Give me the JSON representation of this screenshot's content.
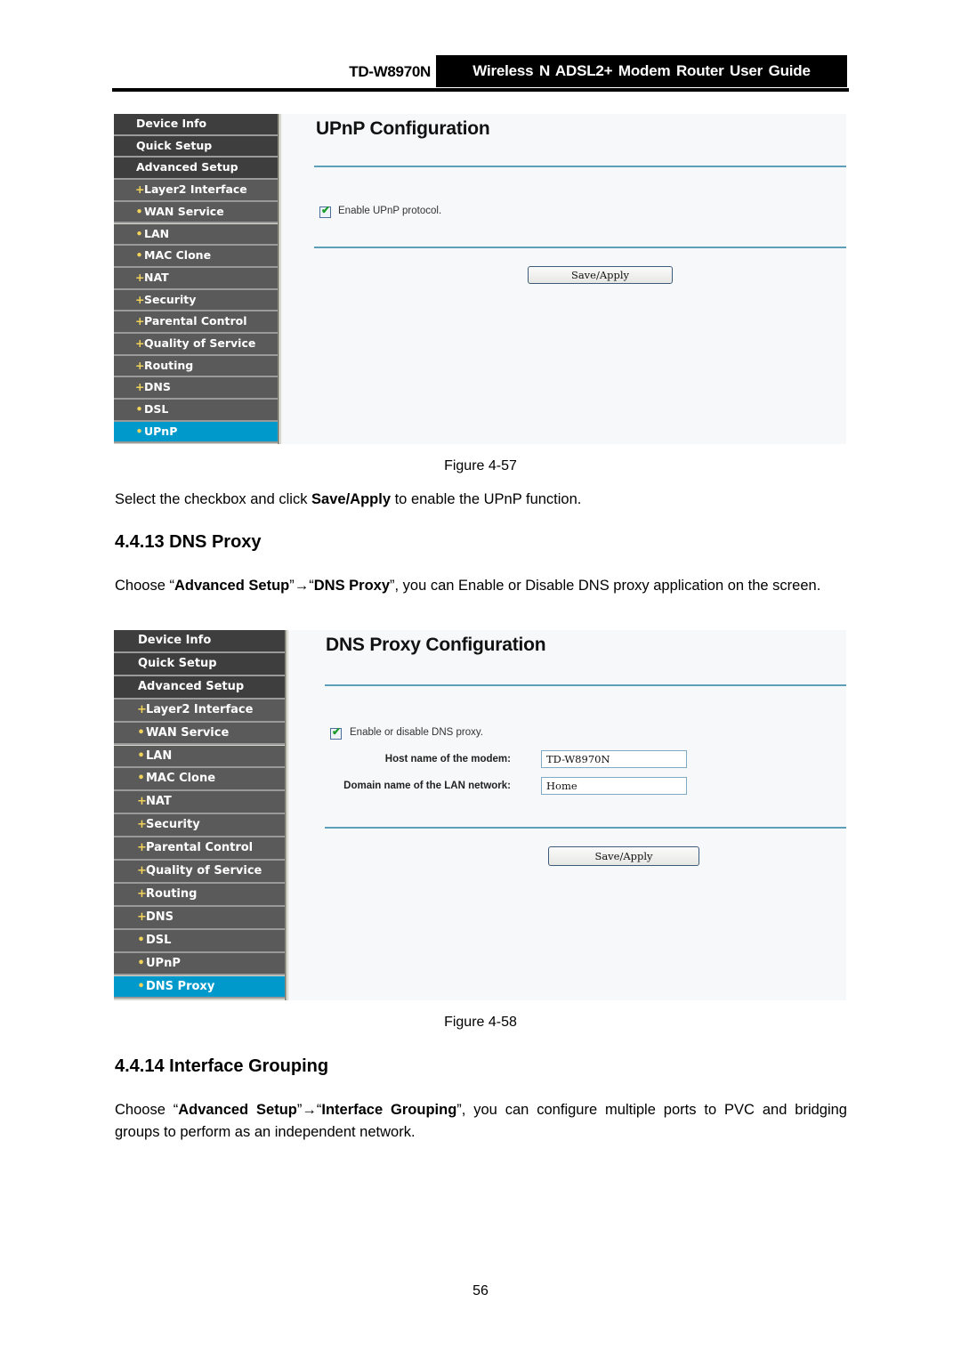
{
  "header": {
    "model": "TD-W8970N",
    "guide_title": "Wireless N ADSL2+ Modem Router User Guide"
  },
  "figure57": {
    "sidebar": [
      {
        "label": "Device Info",
        "bullet": "",
        "level": "top"
      },
      {
        "label": "Quick Setup",
        "bullet": "",
        "level": "top"
      },
      {
        "label": "Advanced Setup",
        "bullet": "",
        "level": "top"
      },
      {
        "label": "Layer2 Interface",
        "bullet": "+",
        "level": "sub"
      },
      {
        "label": "WAN Service",
        "bullet": "•",
        "level": "sub"
      },
      {
        "label": "LAN",
        "bullet": "•",
        "level": "sub"
      },
      {
        "label": "MAC Clone",
        "bullet": "•",
        "level": "sub"
      },
      {
        "label": "NAT",
        "bullet": "+",
        "level": "sub"
      },
      {
        "label": "Security",
        "bullet": "+",
        "level": "sub"
      },
      {
        "label": "Parental Control",
        "bullet": "+",
        "level": "sub"
      },
      {
        "label": "Quality of Service",
        "bullet": "+",
        "level": "sub"
      },
      {
        "label": "Routing",
        "bullet": "+",
        "level": "sub"
      },
      {
        "label": "DNS",
        "bullet": "+",
        "level": "sub"
      },
      {
        "label": "DSL",
        "bullet": "•",
        "level": "sub"
      },
      {
        "label": "UPnP",
        "bullet": "•",
        "level": "active"
      }
    ],
    "title": "UPnP Configuration",
    "checkbox_label": "Enable UPnP protocol.",
    "checkbox_checked": true,
    "save_button": "Save/Apply",
    "caption": "Figure 4-57"
  },
  "text1": {
    "before": "Select the checkbox and click ",
    "bold": "Save/Apply",
    "after": " to enable the UPnP function."
  },
  "section_dns": {
    "heading": "4.4.13 DNS Proxy",
    "p_choose": "Choose “",
    "p_bold1": "Advanced Setup",
    "p_arrow": "”→“",
    "p_bold2": "DNS Proxy",
    "p_rest": "”, you can Enable or Disable DNS proxy application on the screen."
  },
  "figure58": {
    "sidebar": [
      {
        "label": "Device Info",
        "bullet": "",
        "level": "top"
      },
      {
        "label": "Quick Setup",
        "bullet": "",
        "level": "top"
      },
      {
        "label": "Advanced Setup",
        "bullet": "",
        "level": "top"
      },
      {
        "label": "Layer2 Interface",
        "bullet": "+",
        "level": "sub"
      },
      {
        "label": "WAN Service",
        "bullet": "•",
        "level": "sub"
      },
      {
        "label": "LAN",
        "bullet": "•",
        "level": "sub"
      },
      {
        "label": "MAC Clone",
        "bullet": "•",
        "level": "sub"
      },
      {
        "label": "NAT",
        "bullet": "+",
        "level": "sub"
      },
      {
        "label": "Security",
        "bullet": "+",
        "level": "sub"
      },
      {
        "label": "Parental Control",
        "bullet": "+",
        "level": "sub"
      },
      {
        "label": "Quality of Service",
        "bullet": "+",
        "level": "sub"
      },
      {
        "label": "Routing",
        "bullet": "+",
        "level": "sub"
      },
      {
        "label": "DNS",
        "bullet": "+",
        "level": "sub"
      },
      {
        "label": "DSL",
        "bullet": "•",
        "level": "sub"
      },
      {
        "label": "UPnP",
        "bullet": "•",
        "level": "sub"
      },
      {
        "label": "DNS Proxy",
        "bullet": "•",
        "level": "active"
      }
    ],
    "title": "DNS Proxy Configuration",
    "checkbox_label": "Enable or disable DNS proxy.",
    "checkbox_checked": true,
    "host_label": "Host name of the modem:",
    "host_value": "TD-W8970N",
    "domain_label": "Domain name of the LAN network:",
    "domain_value": "Home",
    "save_button": "Save/Apply",
    "caption": "Figure 4-58"
  },
  "section_ig": {
    "heading": "4.4.14 Interface Grouping",
    "p_choose": "Choose “",
    "p_bold1": "Advanced Setup",
    "p_arrow": "”→“",
    "p_bold2": "Interface Grouping",
    "p_rest": "”, you can configure multiple ports to PVC and bridging groups to perform as an independent network."
  },
  "page_number": "56",
  "colors": {
    "sidebar_top": "#3e3e3e",
    "sidebar_sub": "#5a5a5a",
    "sidebar_active": "#0099cc",
    "bullet": "#f2d35a",
    "rule": "#5c9fb8"
  }
}
